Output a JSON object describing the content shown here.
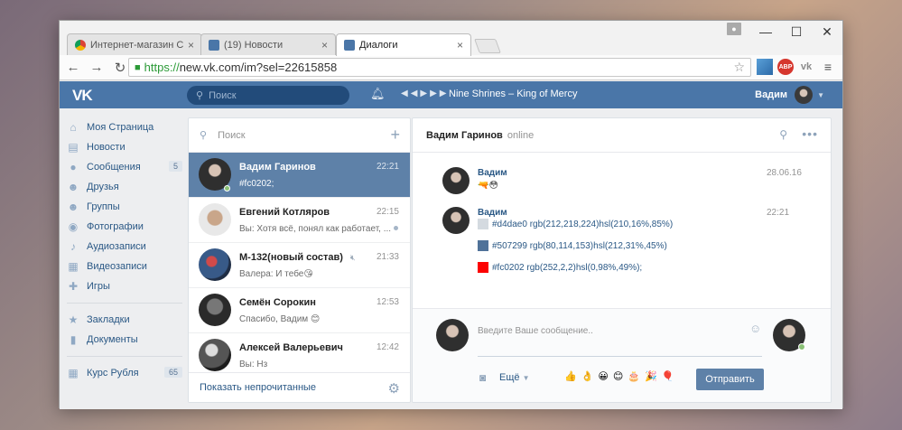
{
  "browser": {
    "tabs": [
      {
        "title": "Интернет-магазин Chrom",
        "close": "×"
      },
      {
        "title": "(19) Новости",
        "close": "×"
      },
      {
        "title": "Диалоги",
        "close": "×"
      }
    ],
    "url_scheme": "https://",
    "url_rest": "new.vk.com/im?sel=22615858",
    "window_controls": {
      "minimize": "—",
      "maximize": "☐",
      "close": "✕"
    },
    "ext_abp": "ABP"
  },
  "vk_header": {
    "logo": "VK",
    "search_placeholder": "Поиск",
    "track": "Nine Shrines – King of Mercy",
    "user_name": "Вадим"
  },
  "sidebar": {
    "items": [
      {
        "label": "Моя Страница",
        "icon": "home-icon"
      },
      {
        "label": "Новости",
        "icon": "news-icon"
      },
      {
        "label": "Сообщения",
        "icon": "messages-icon",
        "badge": "5"
      },
      {
        "label": "Друзья",
        "icon": "friends-icon"
      },
      {
        "label": "Группы",
        "icon": "groups-icon"
      },
      {
        "label": "Фотографии",
        "icon": "camera-icon"
      },
      {
        "label": "Аудиозаписи",
        "icon": "music-icon"
      },
      {
        "label": "Видеозаписи",
        "icon": "video-icon"
      },
      {
        "label": "Игры",
        "icon": "gamepad-icon"
      }
    ],
    "items2": [
      {
        "label": "Закладки",
        "icon": "star-icon"
      },
      {
        "label": "Документы",
        "icon": "document-icon"
      }
    ],
    "items3": [
      {
        "label": "Курс Рубля",
        "icon": "app-icon",
        "badge": "65"
      }
    ]
  },
  "dialogs": {
    "search_placeholder": "Поиск",
    "rows": [
      {
        "name": "Вадим Гаринов",
        "time": "22:21",
        "message": "#fc0202;"
      },
      {
        "name": "Евгений Котляров",
        "time": "22:15",
        "message": "Вы: Хотя всё, понял как работает, ..."
      },
      {
        "name": "М-132(новый состав)",
        "time": "21:33",
        "message": "Валера: И тебе😘"
      },
      {
        "name": "Семён Сорокин",
        "time": "12:53",
        "message": "Спасибо, Вадим 😊"
      },
      {
        "name": "Алексей Валерьевич",
        "time": "12:42",
        "message": "Вы: Нз"
      }
    ],
    "footer": "Показать непрочитанные"
  },
  "chat": {
    "peer_name": "Вадим Гаринов",
    "peer_status": "online",
    "messages": [
      {
        "author": "Вадим",
        "time": "28.06.16",
        "lines": [
          "🔫😳"
        ]
      },
      {
        "author": "Вадим",
        "time": "22:21",
        "lines": [
          {
            "swatch": "#d4dae0",
            "text": "#d4dae0 rgb(212,218,224)hsl(210,16%,85%)"
          },
          {
            "swatch": "#507299",
            "text": "#507299 rgb(80,114,153)hsl(212,31%,45%)"
          },
          {
            "swatch": "#fc0202",
            "text": "#fc0202 rgb(252,2,2)hsl(0,98%,49%);"
          }
        ]
      }
    ],
    "compose_placeholder": "Введите Ваше сообщение..",
    "more_label": "Ещё",
    "quick_emojis": "👍👌😀😊🎂🎉🎈",
    "send_label": "Отправить"
  },
  "colors": {
    "vk_blue": "#4a76a8",
    "active_row": "#5e81a8",
    "link": "#2a5885",
    "online": "#8ac176"
  }
}
